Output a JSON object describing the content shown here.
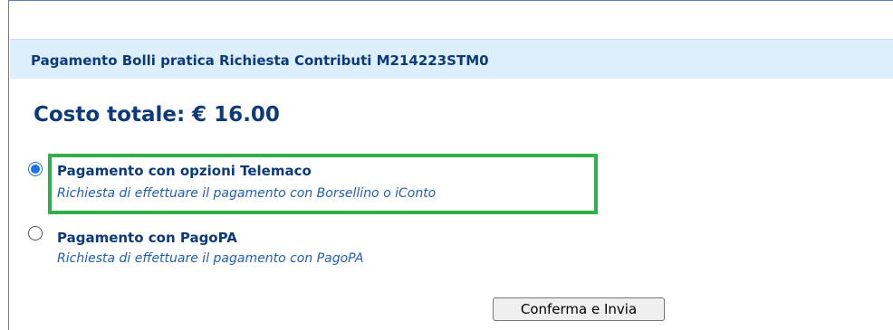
{
  "header": {
    "title": "Pagamento Bolli pratica Richiesta Contributi M214223STM0"
  },
  "total": {
    "label": "Costo totale: € 16.00"
  },
  "options": [
    {
      "title": "Pagamento con opzioni Telemaco",
      "description": "Richiesta di effettuare il pagamento con Borsellino o iConto",
      "selected": true
    },
    {
      "title": "Pagamento con PagoPA",
      "description": "Richiesta di effettuare il pagamento con PagoPA",
      "selected": false
    }
  ],
  "actions": {
    "confirm_label": "Conferma e Invia"
  },
  "colors": {
    "title_blue": "#0d3a7a",
    "desc_blue": "#1f5fb5",
    "header_bg": "#ddeefc",
    "highlight_green": "#2fb04a"
  }
}
